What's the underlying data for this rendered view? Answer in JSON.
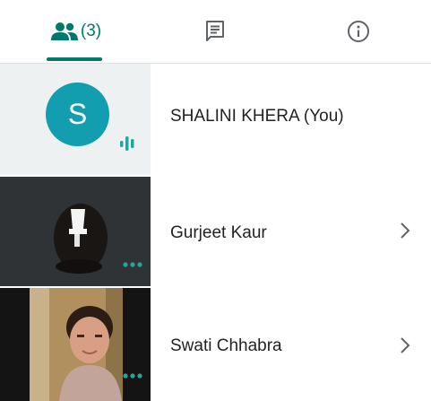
{
  "tabs": {
    "people": {
      "count_label": "(3)",
      "icon": "people-icon"
    },
    "chat": {
      "icon": "chat-icon"
    },
    "info": {
      "icon": "info-icon"
    }
  },
  "participants": [
    {
      "name": "SHALINI KHERA (You)",
      "avatar_letter": "S",
      "avatar_color": "#129eaf",
      "speaking": true
    },
    {
      "name": "Gurjeet Kaur"
    },
    {
      "name": "Swati Chhabra"
    }
  ],
  "colors": {
    "accent": "#00796b",
    "indicator": "#26a69a"
  }
}
